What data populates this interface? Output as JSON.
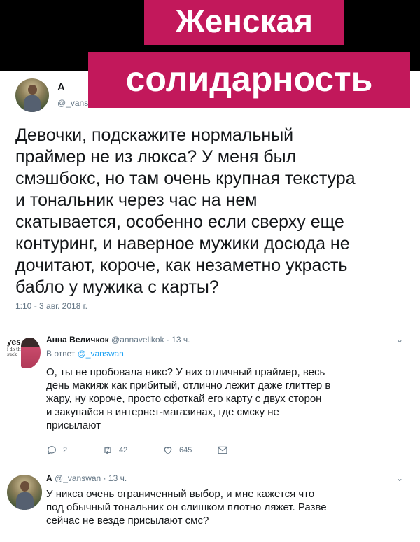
{
  "banner": {
    "line1": "Женская",
    "line2": "солидарность"
  },
  "main_tweet": {
    "name": "А",
    "handle": "@_vans",
    "text_lines": [
      "Девочки, подскажите нормальный",
      "праймер не из люкса? У меня был",
      "смэшбокс,  но там очень крупная текстура",
      "и тональник через час на нем",
      "скатывается,  особенно если сверху еще",
      "контуринг, и наверное мужики досюда не",
      "дочитают, короче, как незаметно украсть",
      "бабло у мужика с карты?"
    ],
    "timestamp": "1:10 - 3 авг. 2018 г."
  },
  "reply1": {
    "name": "Анна Величкок",
    "handle": "@annavelikok",
    "time": "· 13 ч.",
    "reply_to_prefix": "В ответ",
    "reply_to_handle": "@_vanswan",
    "avatar_text": "yes.",
    "avatar_subtext": "i do think you suck",
    "text_lines": [
      "О, ты не пробовала никс? У них отличный праймер, весь",
      "день макияж как прибитый, отлично лежит даже глиттер в",
      "жару, ну короче, просто сфоткай его карту с двух сторон",
      "и закупайся в интернет-магазинах, где смску не",
      "присылают"
    ],
    "actions": {
      "reply_count": "2",
      "retweet_count": "42",
      "like_count": "645"
    },
    "icons": [
      "reply-icon",
      "retweet-icon",
      "like-icon",
      "message-icon",
      "chevron-down-icon"
    ]
  },
  "reply2": {
    "name": "А",
    "handle": "@_vanswan",
    "time": "· 13 ч.",
    "text_lines": [
      "У никса очень ограниченный выбор, и мне кажется что",
      "под обычный тональник он слишком плотно ляжет. Разве",
      "сейчас не везде присылают смс?"
    ]
  }
}
